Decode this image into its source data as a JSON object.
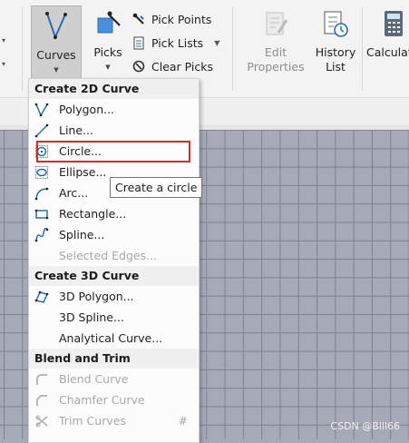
{
  "ribbon": {
    "curves_label": "Curves",
    "picks_label": "Picks",
    "pick_points": "Pick Points",
    "pick_lists": "Pick Lists",
    "clear_picks": "Clear Picks",
    "edit_line1": "Edit",
    "edit_line2": "Properties",
    "history_line1": "History",
    "history_line2": "List",
    "calc_label": "Calculat"
  },
  "menu": {
    "section_2d": "Create 2D Curve",
    "items_2d": [
      {
        "label": "Polygon...",
        "icon": "polygon-icon",
        "enabled": true
      },
      {
        "label": "Line...",
        "icon": "line-icon",
        "enabled": true
      },
      {
        "label": "Circle...",
        "icon": "circle-icon",
        "enabled": true
      },
      {
        "label": "Ellipse...",
        "icon": "ellipse-icon",
        "enabled": true
      },
      {
        "label": "Arc...",
        "icon": "arc-icon",
        "enabled": true
      },
      {
        "label": "Rectangle...",
        "icon": "rectangle-icon",
        "enabled": true
      },
      {
        "label": "Spline...",
        "icon": "spline-icon",
        "enabled": true
      },
      {
        "label": "Selected Edges...",
        "icon": "",
        "enabled": false
      }
    ],
    "section_3d": "Create 3D Curve",
    "items_3d": [
      {
        "label": "3D Polygon...",
        "icon": "polygon-3d-icon",
        "enabled": true
      },
      {
        "label": "3D Spline...",
        "icon": "",
        "enabled": true
      },
      {
        "label": "Analytical Curve...",
        "icon": "",
        "enabled": true
      }
    ],
    "section_blend": "Blend and Trim",
    "items_blend": [
      {
        "label": "Blend Curve",
        "icon": "blend-curve-icon",
        "enabled": false
      },
      {
        "label": "Chamfer Curve",
        "icon": "chamfer-curve-icon",
        "enabled": false
      },
      {
        "label": "Trim Curves",
        "icon": "trim-curves-icon",
        "enabled": false,
        "shortcut": "#"
      }
    ]
  },
  "tooltip": "Create a circle",
  "watermark": "CSDN @Bill66",
  "colors": {
    "highlight_border": "#d02c2c",
    "viewport": "#a6a9b6",
    "grid_line": "#7d8190"
  }
}
